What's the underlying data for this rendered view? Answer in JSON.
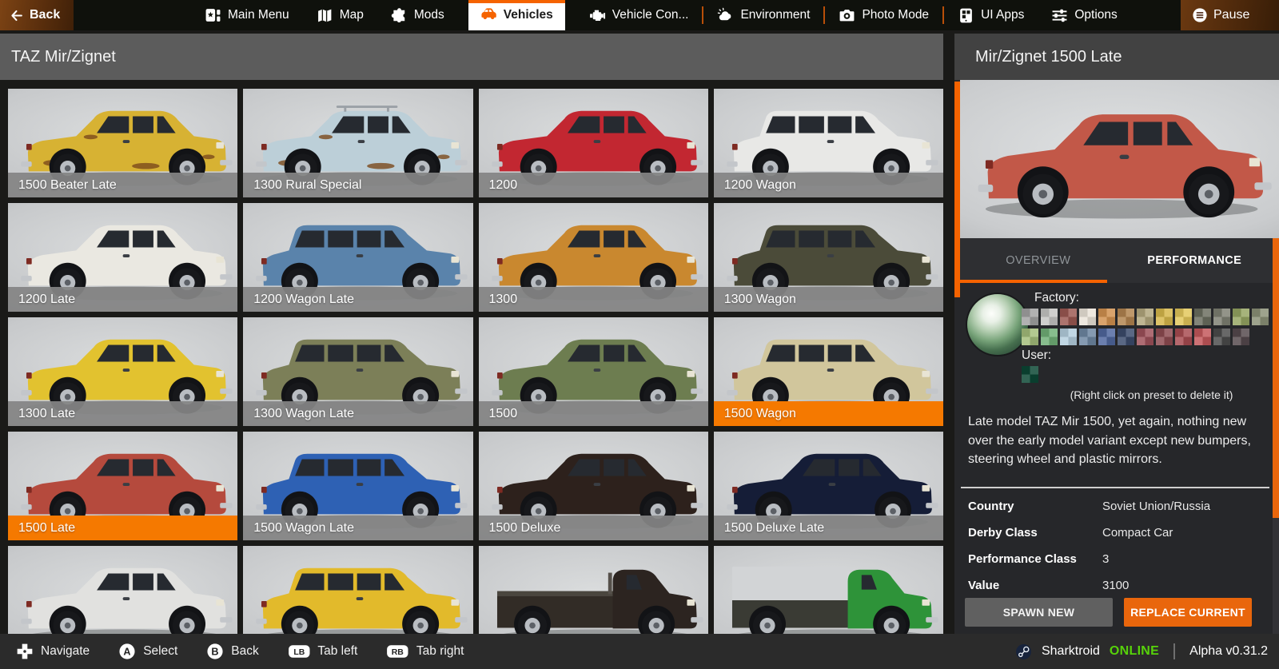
{
  "top_bar": {
    "back_label": "Back",
    "pause_label": "Pause",
    "tabs": [
      {
        "label": "Main Menu",
        "icon": "main-menu"
      },
      {
        "label": "Map",
        "icon": "map"
      },
      {
        "label": "Mods",
        "icon": "mods"
      },
      {
        "label": "Vehicles",
        "icon": "vehicles",
        "selected": true
      },
      {
        "label": "Vehicle Con...",
        "icon": "engine"
      },
      {
        "label": "Environment",
        "icon": "environment",
        "divider_before": true
      },
      {
        "label": "Photo Mode",
        "icon": "camera",
        "divider_before": true
      },
      {
        "label": "UI Apps",
        "icon": "ui-apps",
        "divider_before": true
      },
      {
        "label": "Options",
        "icon": "options"
      }
    ]
  },
  "header": {
    "title": "TAZ Mir/Zignet"
  },
  "grid": {
    "vehicles": [
      {
        "name": "1500 Beater Late",
        "color": "#d7b233",
        "body": "sedan",
        "rust": true
      },
      {
        "name": "1300 Rural Special",
        "color": "#bccfd8",
        "body": "sedan",
        "rack": true,
        "rust": true
      },
      {
        "name": "1200",
        "color": "#c22731",
        "body": "sedan"
      },
      {
        "name": "1200 Wagon",
        "color": "#e8e8e6",
        "body": "wagon"
      },
      {
        "name": "1200 Late",
        "color": "#eae8e1",
        "body": "sedan"
      },
      {
        "name": "1200 Wagon Late",
        "color": "#5a83ab",
        "body": "wagon"
      },
      {
        "name": "1300",
        "color": "#c9882f",
        "body": "sedan"
      },
      {
        "name": "1300 Wagon",
        "color": "#4b4b39",
        "body": "wagon"
      },
      {
        "name": "1300 Late",
        "color": "#e2c22f",
        "body": "sedan"
      },
      {
        "name": "1300 Wagon Late",
        "color": "#7c7f58",
        "body": "wagon"
      },
      {
        "name": "1500",
        "color": "#6d7d50",
        "body": "sedan"
      },
      {
        "name": "1500 Wagon",
        "color": "#d1c69c",
        "body": "wagon",
        "selected": true
      },
      {
        "name": "1500 Late",
        "color": "#b54a3d",
        "body": "sedan",
        "selected": true
      },
      {
        "name": "1500 Wagon Late",
        "color": "#2e61b4",
        "body": "wagon"
      },
      {
        "name": "1500 Deluxe",
        "color": "#2d211c",
        "body": "sedan"
      },
      {
        "name": "1500 Deluxe Late",
        "color": "#151d37",
        "body": "sedan"
      },
      {
        "name": "",
        "color": "#e1e1df",
        "body": "sedan"
      },
      {
        "name": "",
        "color": "#e2ba2b",
        "body": "wagon"
      },
      {
        "name": "",
        "color": "#2c2420",
        "body": "truck"
      },
      {
        "name": "",
        "color": "#2e9339",
        "body": "truck_canopy"
      }
    ]
  },
  "panel": {
    "title": "Mir/Zignet 1500 Late",
    "preview": {
      "color": "#c25848",
      "body": "sedan"
    },
    "tab_overview": "OVERVIEW",
    "tab_performance": "PERFORMANCE",
    "factory_label": "Factory:",
    "user_label": "User:",
    "factory_colors_row1": [
      "#a2a2a2",
      "#c6c6c4",
      "#9c5952",
      "#ebe4d9",
      "#d29250",
      "#b2844f",
      "#b2a77d",
      "#d7b84b",
      "#e3c75b",
      "#6b6e5f",
      "#7e8073",
      "#95a562",
      "#8c9277"
    ],
    "factory_colors_row2": [
      "#a4bd7b",
      "#70af77",
      "#b5cfdf",
      "#6e87a2",
      "#4f679e",
      "#3b4b6c",
      "#9e515a",
      "#8e4b51",
      "#a84b51",
      "#c3575b",
      "#4b4b4b",
      "#55494d"
    ],
    "user_colors": [
      "#0b4734"
    ],
    "preset_hint": "(Right click on preset to delete it)",
    "description": "Late model TAZ Mir 1500, yet again, nothing new over the early model variant except new bumpers, steering wheel and plastic mirrors.",
    "specs": [
      {
        "label": "Country",
        "value": "Soviet Union/Russia"
      },
      {
        "label": "Derby Class",
        "value": "Compact Car"
      },
      {
        "label": "Performance Class",
        "value": "3"
      },
      {
        "label": "Value",
        "value": "3100"
      }
    ],
    "spawn_label": "SPAWN NEW",
    "replace_label": "REPLACE CURRENT"
  },
  "bottom_bar": {
    "hints": [
      {
        "icon": "dpad",
        "label": "Navigate"
      },
      {
        "icon": "button-a",
        "key": "A",
        "label": "Select"
      },
      {
        "icon": "button-b",
        "key": "B",
        "label": "Back"
      },
      {
        "icon": "button-lb",
        "key": "LB",
        "label": "Tab left"
      },
      {
        "icon": "button-rb",
        "key": "RB",
        "label": "Tab right"
      }
    ],
    "player_name": "Sharktroid",
    "player_status": "ONLINE",
    "version": "Alpha v0.31.2"
  },
  "colors": {
    "accent_orange": "#f56300",
    "selected_label_orange": "#f57900",
    "button_orange": "#e9660c",
    "online_green": "#57d20a"
  }
}
